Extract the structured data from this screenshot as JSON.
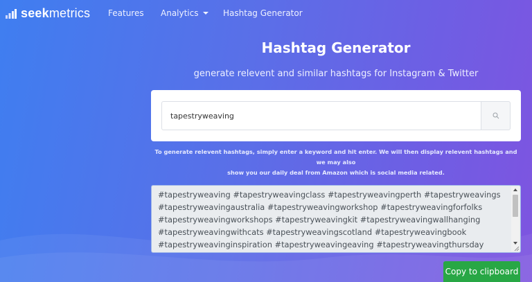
{
  "brand": {
    "bold": "seek",
    "light": "metrics",
    "icon": "bar-chart-logo-icon"
  },
  "nav": {
    "features": "Features",
    "analytics": "Analytics",
    "hashtag_generator": "Hashtag Generator"
  },
  "hero": {
    "title": "Hashtag Generator",
    "subtitle": "generate relevent and similar hashtags for Instagram & Twitter"
  },
  "search": {
    "value": "tapestryweaving",
    "icon": "search-icon"
  },
  "help": {
    "line1": "To generate relevent hashtags, simply enter a keyword and hit enter. We will then display relevent hashtags and we may also",
    "line2": "show you our daily deal from Amazon which is social media related."
  },
  "results": {
    "lines": [
      "#tapestryweaving #tapestryweavingclass #tapestryweavingperth #tapestryweavings",
      "#tapestryweavingaustralia #tapestryweavingworkshop #tapestryweavingforfolks",
      "#tapestryweavingworkshops #tapestryweavingkit #tapestryweavingwallhanging",
      "#tapestryweavingwithcats #tapestryweavingscotland #tapestryweavingbook",
      "#tapestryweavinginspiration #tapestryweavingeaving #tapestryweavingthursday"
    ]
  },
  "copy_button": "Copy to clipboard",
  "colors": {
    "accent_green": "#28a745",
    "gradient_start": "#3f7ef0",
    "gradient_end": "#7e54e0"
  }
}
